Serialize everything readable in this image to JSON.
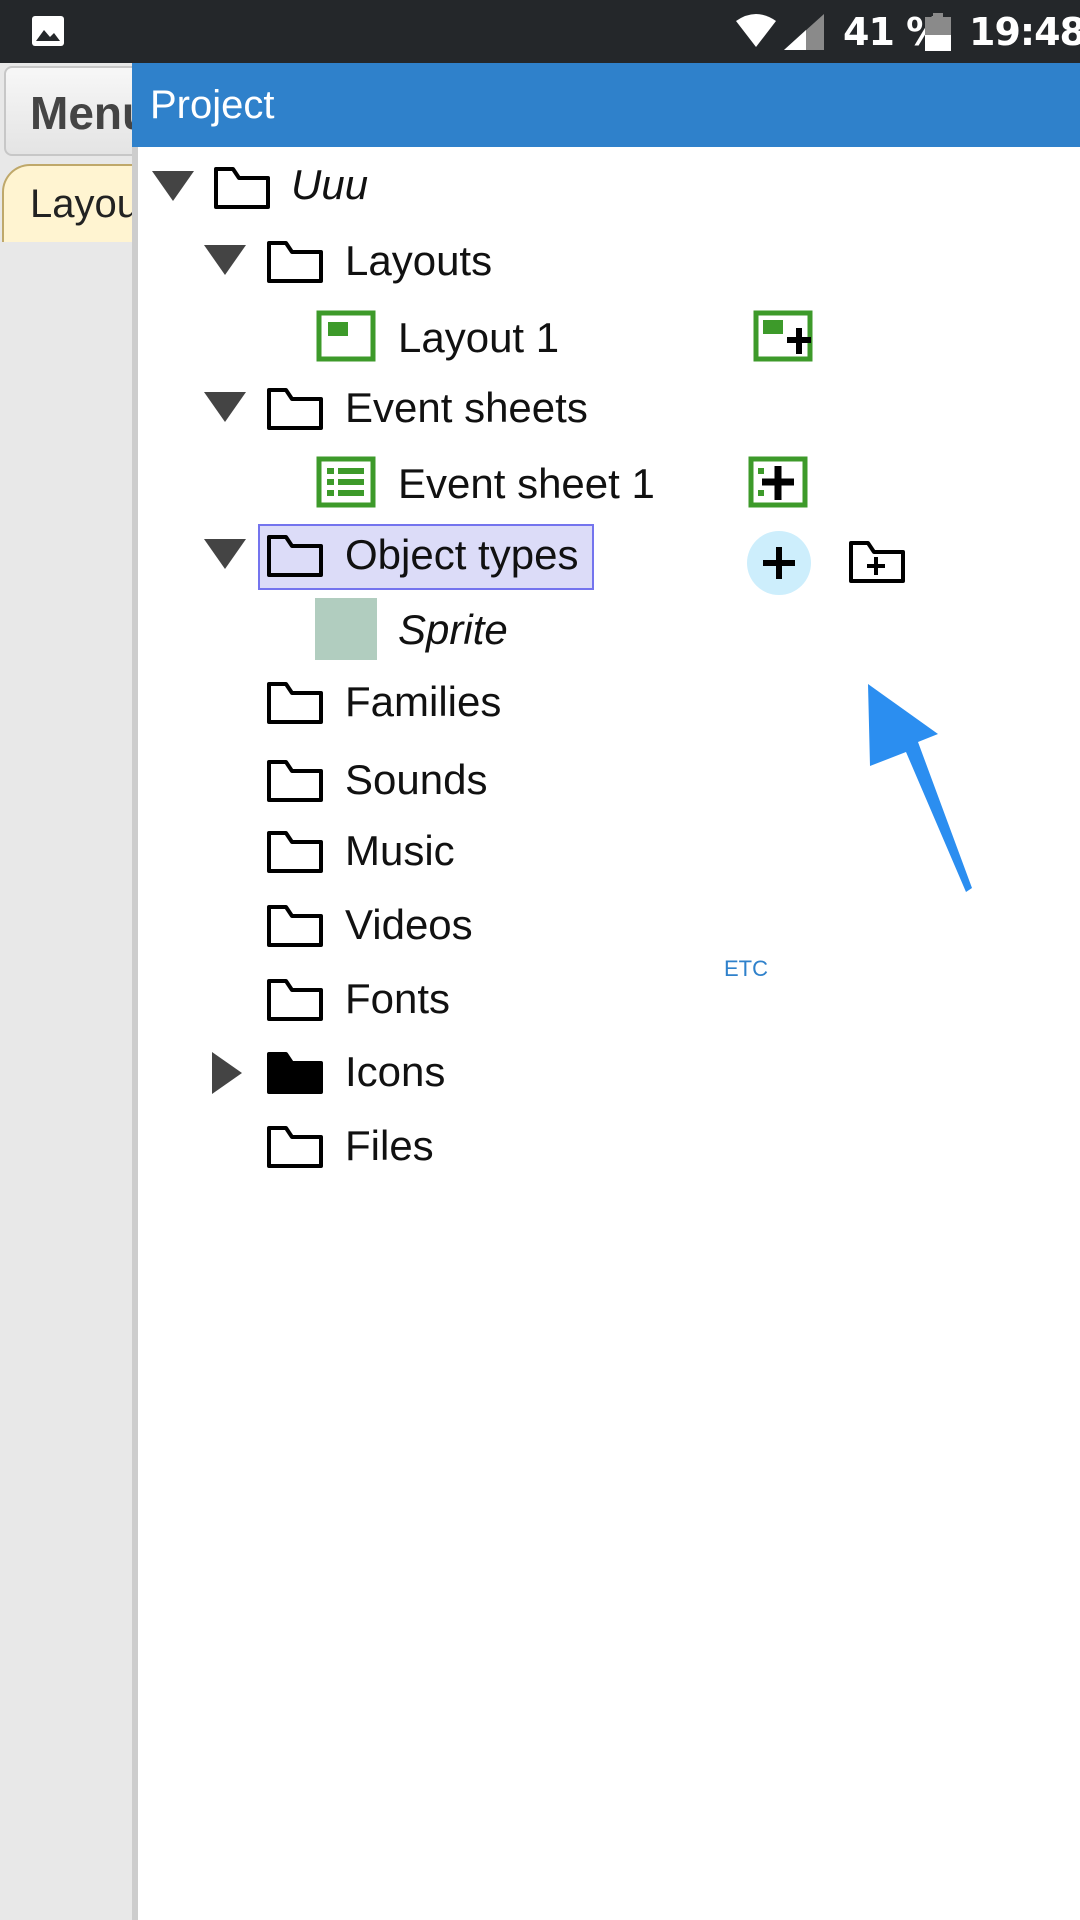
{
  "status_bar": {
    "battery_percent": "41 %",
    "time": "19:48",
    "icons": [
      "gallery-icon",
      "wifi-icon",
      "signal-icon",
      "battery-icon"
    ]
  },
  "background_app": {
    "menu_button": "Menu",
    "tab_label": "Layout"
  },
  "panel": {
    "title": "Project"
  },
  "tree": {
    "root": "Uuu",
    "layouts": "Layouts",
    "layout1": "Layout 1",
    "event_sheets": "Event sheets",
    "event_sheet1": "Event sheet 1",
    "object_types": "Object types",
    "sprite": "Sprite",
    "families": "Families",
    "sounds": "Sounds",
    "music": "Music",
    "videos": "Videos",
    "fonts": "Fonts",
    "icons": "Icons",
    "files": "Files"
  },
  "annotation": {
    "etc": "ETC"
  },
  "colors": {
    "header": "#2f81cb",
    "selection_bg": "#dcdcf8",
    "selection_border": "#7474ee",
    "green_icon": "#3d9a2a",
    "sprite_swatch": "#b1cdbf",
    "arrow": "#2b8ef0",
    "add_button_bg": "#cdeefc"
  }
}
